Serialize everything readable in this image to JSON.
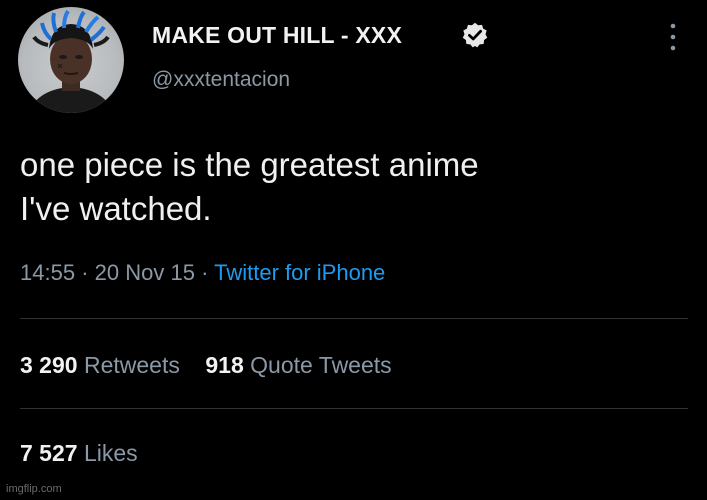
{
  "author": {
    "name": "MAKE OUT HILL - XXX",
    "handle": "@xxxtentacion",
    "verified": true
  },
  "tweet": {
    "text_line1": "one piece is the greatest anime",
    "text_line2": "I've watched.",
    "time": "14:55",
    "date": "20 Nov 15",
    "separator": "·",
    "client": "Twitter for iPhone"
  },
  "stats": {
    "retweets_count": "3 290",
    "retweets_label": "Retweets",
    "quotes_count": "918",
    "quotes_label": "Quote Tweets",
    "likes_count": "7 527",
    "likes_label": "Likes"
  },
  "watermark": "imgflip.com",
  "colors": {
    "background": "#000000",
    "text": "#e7e9ea",
    "secondary": "#8b98a5",
    "link": "#1d9bf0",
    "divider": "#2f3336"
  },
  "icons": {
    "verified": "verified-badge-icon",
    "more": "more-vertical-icon"
  }
}
